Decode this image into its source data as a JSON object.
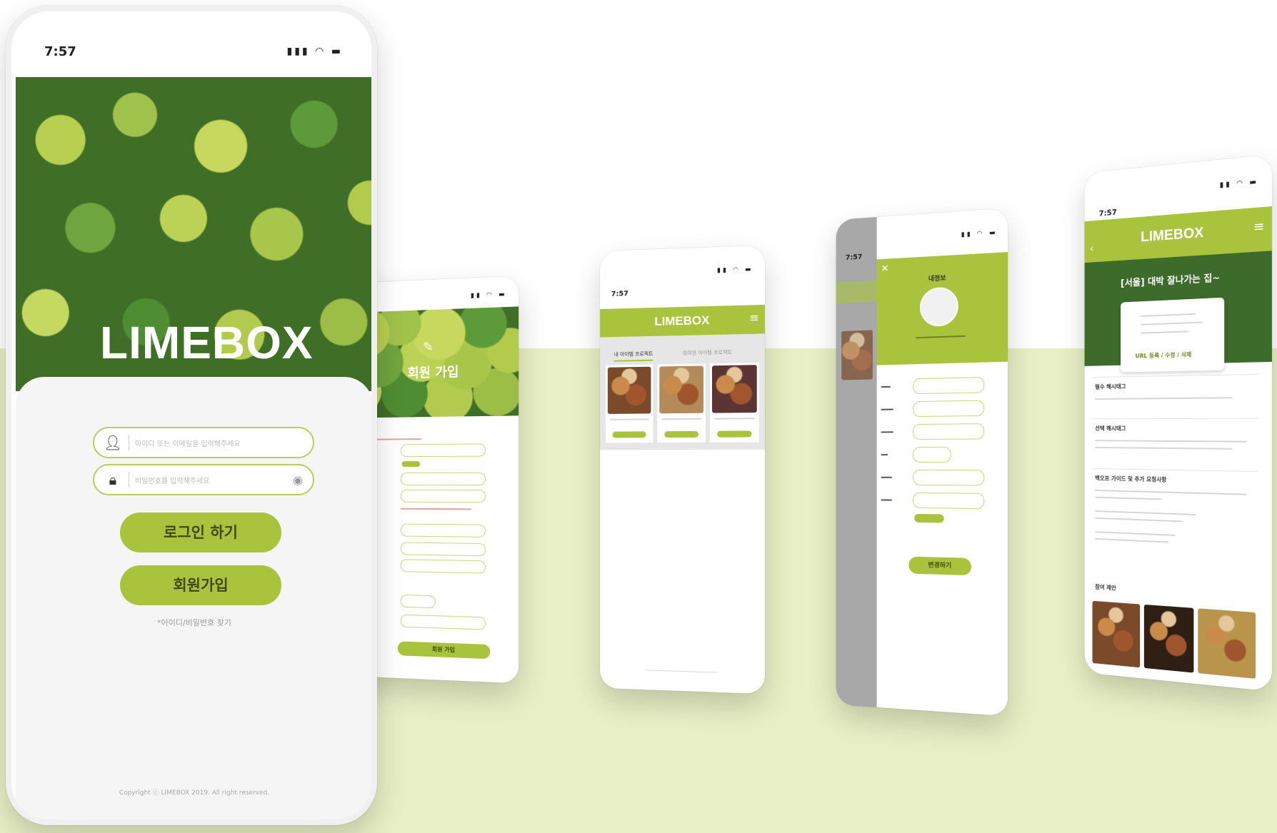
{
  "status": {
    "time": "7:57"
  },
  "brand": {
    "logo": "LIMEBOX"
  },
  "login": {
    "id_placeholder": "아이디 또는 이메일을 입력해주세요",
    "pw_placeholder": "비밀번호를 입력해주세요",
    "login_button": "로그인 하기",
    "signup_button": "회원가입",
    "find_link": "*아이디/비밀번호 찾기",
    "copyright": "Copyright ⓒ LIMEBOX 2019. All right reserved."
  },
  "signup": {
    "title": "회원 가입",
    "submit": "회원 가입"
  },
  "home": {
    "tabs": [
      "내 아이템 프로젝트",
      "참여한 아이템 프로젝트"
    ]
  },
  "profile": {
    "title": "내정보",
    "save": "변경하기"
  },
  "detail": {
    "title": "[서울] 대박 잘나가는 집~",
    "url_actions": "URL 등록 / 수정 / 삭제",
    "sections": [
      "필수 해시태그",
      "선택 해시태그",
      "백오프 가이드 및 추가 요청사항",
      "참여 제안"
    ]
  },
  "colors": {
    "accent": "#a9c43c",
    "band": "#e8efc4",
    "dark": "#3d6b2b"
  },
  "icons": [
    "user-icon",
    "lock-icon",
    "eye-icon",
    "signal-icon",
    "wifi-icon",
    "battery-icon",
    "close-icon",
    "avatar-icon",
    "menu-icon",
    "back-icon"
  ]
}
